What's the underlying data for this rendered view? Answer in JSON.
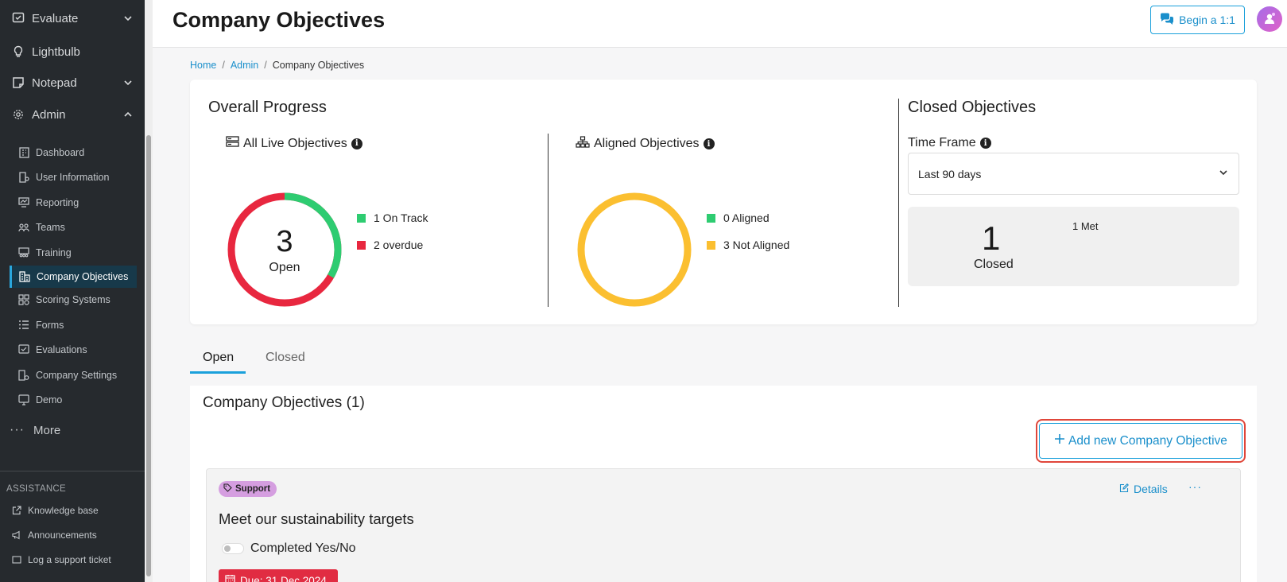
{
  "sidebar": {
    "main": [
      {
        "label": "Evaluate",
        "icon": "evaluate-icon",
        "chevron": "down"
      },
      {
        "label": "Lightbulb",
        "icon": "lightbulb-icon",
        "chevron": ""
      },
      {
        "label": "Notepad",
        "icon": "notepad-icon",
        "chevron": "down"
      },
      {
        "label": "Admin",
        "icon": "gear-icon",
        "chevron": "up"
      }
    ],
    "admin_items": [
      {
        "label": "Dashboard",
        "icon": "dashboard-icon"
      },
      {
        "label": "User Information",
        "icon": "user-information-icon"
      },
      {
        "label": "Reporting",
        "icon": "reporting-icon"
      },
      {
        "label": "Teams",
        "icon": "teams-icon"
      },
      {
        "label": "Training",
        "icon": "training-icon"
      },
      {
        "label": "Company Objectives",
        "icon": "company-objectives-icon",
        "active": true
      },
      {
        "label": "Scoring Systems",
        "icon": "scoring-systems-icon"
      },
      {
        "label": "Forms",
        "icon": "forms-icon"
      },
      {
        "label": "Evaluations",
        "icon": "evaluations-icon"
      },
      {
        "label": "Company Settings",
        "icon": "company-settings-icon"
      },
      {
        "label": "Demo",
        "icon": "demo-icon"
      }
    ],
    "more_label": "More",
    "assistance_title": "ASSISTANCE",
    "assistance_items": [
      {
        "label": "Knowledge base",
        "icon": "external-link-icon"
      },
      {
        "label": "Announcements",
        "icon": "megaphone-icon"
      },
      {
        "label": "Log a support ticket",
        "icon": "ticket-icon"
      }
    ]
  },
  "header": {
    "title": "Company Objectives",
    "begin_button": "Begin a 1:1"
  },
  "breadcrumb": {
    "home": "Home",
    "admin": "Admin",
    "current": "Company Objectives",
    "separator": "/"
  },
  "overview": {
    "title": "Overall Progress",
    "live": {
      "label": "All Live Objectives",
      "count": "3",
      "count_label": "Open",
      "legend": [
        {
          "label": "1 On Track",
          "color": "#2ecc71",
          "value": 1
        },
        {
          "label": "2 overdue",
          "color": "#e8273f",
          "value": 2
        }
      ]
    },
    "aligned": {
      "label": "Aligned Objectives",
      "legend": [
        {
          "label": "0 Aligned",
          "color": "#2ecc71",
          "value": 0
        },
        {
          "label": "3 Not Aligned",
          "color": "#fbbf30",
          "value": 3
        }
      ]
    },
    "closed": {
      "title": "Closed Objectives",
      "time_frame_label": "Time Frame",
      "time_frame_value": "Last 90 days",
      "count": "1",
      "count_label": "Closed",
      "met": "1 Met"
    }
  },
  "tabs": [
    {
      "label": "Open",
      "active": true
    },
    {
      "label": "Closed",
      "active": false
    }
  ],
  "objectives": {
    "heading": "Company Objectives (1)",
    "add_button": "Add new Company Objective",
    "items": [
      {
        "tag": "Support",
        "title": "Meet our sustainability targets",
        "toggle_label": "Completed Yes/No",
        "due": "Due: 31 Dec 2024",
        "details_label": "Details",
        "more_label": "···"
      }
    ]
  },
  "colors": {
    "accent": "#1aa0db",
    "sidebar_bg": "#262a2e",
    "on_track": "#2ecc71",
    "overdue": "#e8273f",
    "not_aligned": "#fbbf30",
    "due_badge": "#e12c42",
    "tag": "#d59ee0"
  }
}
